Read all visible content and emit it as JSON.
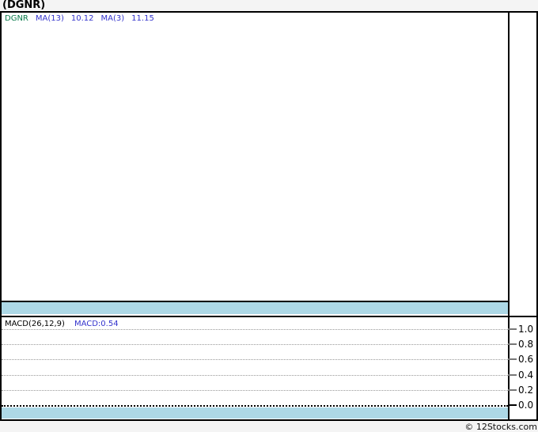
{
  "title": "(DGNR)",
  "legend": {
    "symbol": "DGNR",
    "symbol_color": "#0a7a4a",
    "ma13_label": "MA(13)",
    "ma13_value": "10.12",
    "ma3_label": "MA(3)",
    "ma3_value": "11.15",
    "ma_text_color": "#3333cc"
  },
  "macd": {
    "label": "MACD(26,12,9)",
    "value": "MACD:0.54",
    "value_color": "#3333cc",
    "axis_ticks": [
      "1.0",
      "0.8",
      "0.6",
      "0.4",
      "0.2",
      "0.0"
    ]
  },
  "footer": "© 12Stocks.com",
  "colors": {
    "band_lightblue": "#add8e6",
    "grid_dotted_gray": "#999999",
    "zero_line_black": "#000000",
    "page_background": "#f4f4f4",
    "plot_background": "#ffffff",
    "border_black": "#000000"
  },
  "chart_data": [
    {
      "type": "line",
      "title": "(DGNR) price pane with moving averages",
      "series": [
        {
          "name": "DGNR",
          "values": []
        },
        {
          "name": "MA(13)",
          "last_value": 10.12,
          "values": []
        },
        {
          "name": "MA(3)",
          "last_value": 11.15,
          "values": []
        }
      ],
      "legend_position": "top-left",
      "grid": false,
      "note": "Price pane is empty in the screenshot — no plotted data points visible"
    },
    {
      "type": "line",
      "title": "MACD(26,12,9)",
      "series": [
        {
          "name": "MACD",
          "last_value": 0.54,
          "values": []
        }
      ],
      "ylim": [
        0.0,
        1.0
      ],
      "yticks": [
        1.0,
        0.8,
        0.6,
        0.4,
        0.2,
        0.0
      ],
      "ytick_side": "right",
      "grid": "horizontal dotted; 0.0 baseline is a dense black dotted line",
      "legend_position": "top-left",
      "note": "MACD pane shows gridlines only — no plotted line visible"
    }
  ]
}
